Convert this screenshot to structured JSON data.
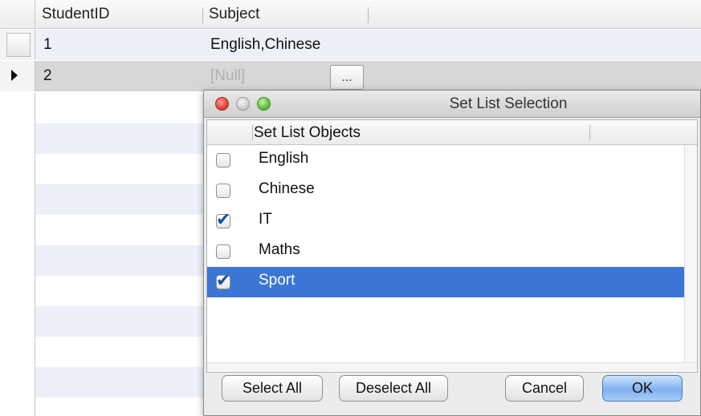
{
  "grid": {
    "columns": [
      "StudentID",
      "Subject"
    ],
    "rows": [
      {
        "id": "1",
        "subject": "English,Chinese"
      },
      {
        "id": "2",
        "subject": "[Null]"
      }
    ],
    "ellipsis_label": "..."
  },
  "dialog": {
    "title": "Set List Selection",
    "list_header": "Set List Objects",
    "items": [
      {
        "label": "English",
        "checked": false,
        "selected": false
      },
      {
        "label": "Chinese",
        "checked": false,
        "selected": false
      },
      {
        "label": "IT",
        "checked": true,
        "selected": false
      },
      {
        "label": "Maths",
        "checked": false,
        "selected": false
      },
      {
        "label": "Sport",
        "checked": true,
        "selected": true
      }
    ],
    "buttons": {
      "select_all": "Select All",
      "deselect_all": "Deselect All",
      "cancel": "Cancel",
      "ok": "OK"
    },
    "check_glyph": "✔"
  },
  "colors": {
    "selection": "#3b76d6",
    "row_stripe": "#edf0f9",
    "active_row": "#d7d7d7"
  }
}
